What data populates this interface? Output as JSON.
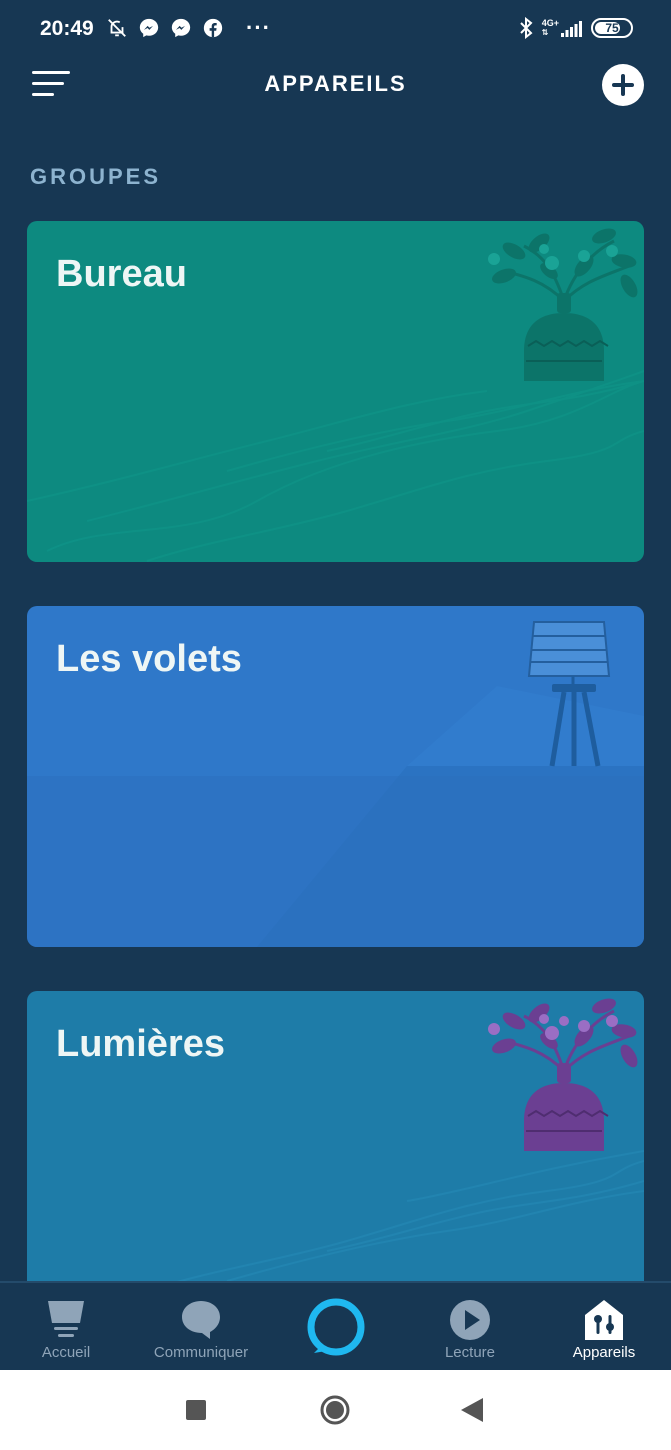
{
  "status_bar": {
    "time": "20:49",
    "network": "4G+",
    "battery": "75",
    "battery_level": 0.75,
    "left_icons": [
      "bell-off-icon",
      "messenger-icon",
      "messenger-icon",
      "facebook-icon"
    ],
    "overflow": "···",
    "right_icons": [
      "bluetooth-icon",
      "signal-icon",
      "battery-icon"
    ]
  },
  "header": {
    "title": "APPAREILS",
    "menu_icon": "menu-icon",
    "add_icon": "plus-icon"
  },
  "section": {
    "label": "GROUPES"
  },
  "groups": [
    {
      "name": "Bureau",
      "color": "#0d8a80",
      "illustration": "plant-vase-icon"
    },
    {
      "name": "Les volets",
      "color": "#2f78c9",
      "illustration": "floor-lamp-icon"
    },
    {
      "name": "Lumières",
      "color": "#1e7ca8",
      "illustration": "plant-vase-icon"
    }
  ],
  "bottom_nav": {
    "items": [
      {
        "label": "Accueil",
        "icon": "home-icon",
        "active": false
      },
      {
        "label": "Communiquer",
        "icon": "chat-bubble-icon",
        "active": false
      },
      {
        "label": "",
        "icon": "alexa-icon",
        "active": false
      },
      {
        "label": "Lecture",
        "icon": "play-icon",
        "active": false
      },
      {
        "label": "Appareils",
        "icon": "devices-icon",
        "active": true
      }
    ],
    "active_color": "#ffffff",
    "inactive_color": "#8fa4b8",
    "alexa_color": "#1fb8f0"
  },
  "system_nav": {
    "buttons": [
      "recents-square-icon",
      "home-circle-icon",
      "back-triangle-icon"
    ]
  }
}
